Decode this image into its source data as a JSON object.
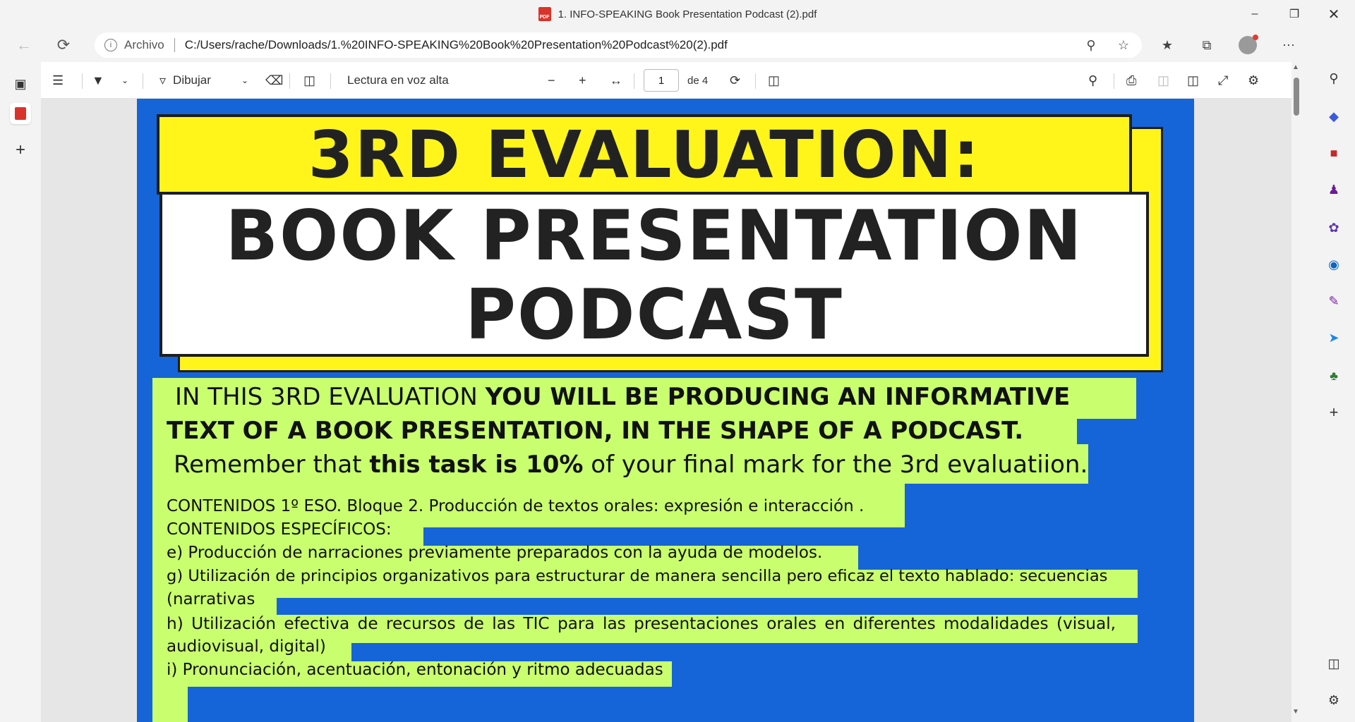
{
  "window": {
    "title": "1. INFO-SPEAKING Book Presentation Podcast (2).pdf",
    "pdf_badge": "PDF"
  },
  "address": {
    "label": "Archivo",
    "url": "C:/Users/rache/Downloads/1.%20INFO-SPEAKING%20Book%20Presentation%20Podcast%20(2).pdf"
  },
  "toolbar": {
    "draw_label": "Dibujar",
    "read_aloud_label": "Lectura en voz alta",
    "page_number": "1",
    "page_total": "de 4"
  },
  "document": {
    "title_line1": "3RD EVALUATION:",
    "title_line2": "BOOK PRESENTATION",
    "title_line3": "PODCAST",
    "intro_line1_normal": "IN THIS 3RD EVALUATION ",
    "intro_line1_bold": "YOU WILL BE PRODUCING AN INFORMATIVE",
    "intro_line2_bold": "TEXT OF A BOOK PRESENTATION, IN THE SHAPE OF A PODCAST.",
    "intro_line3_a": "Remember that ",
    "intro_line3_bold": "this task is 10%",
    "intro_line3_b": " of your final mark for the 3rd evaluatiion.",
    "contenidos": [
      "CONTENIDOS 1º ESO. Bloque 2. Producción de textos orales: expresión e interacción .",
      "CONTENIDOS ESPECÍFICOS:",
      "e) Producción de narraciones previamente preparados con la ayuda de modelos.",
      "g) Utilización de principios organizativos para estructurar de manera sencilla pero eficaz el texto hablado: secuencias",
      "(narrativas",
      "h) Utilización efectiva de recursos de las TIC para las presentaciones orales en diferentes modalidades (visual,",
      "audiovisual, digital)",
      "i) Pronunciación, acentuación, entonación y ritmo adecuadas"
    ]
  },
  "colors": {
    "page_blue": "#1565d8",
    "title_yellow": "#fff51a",
    "highlight_green": "#c9ff6e"
  }
}
